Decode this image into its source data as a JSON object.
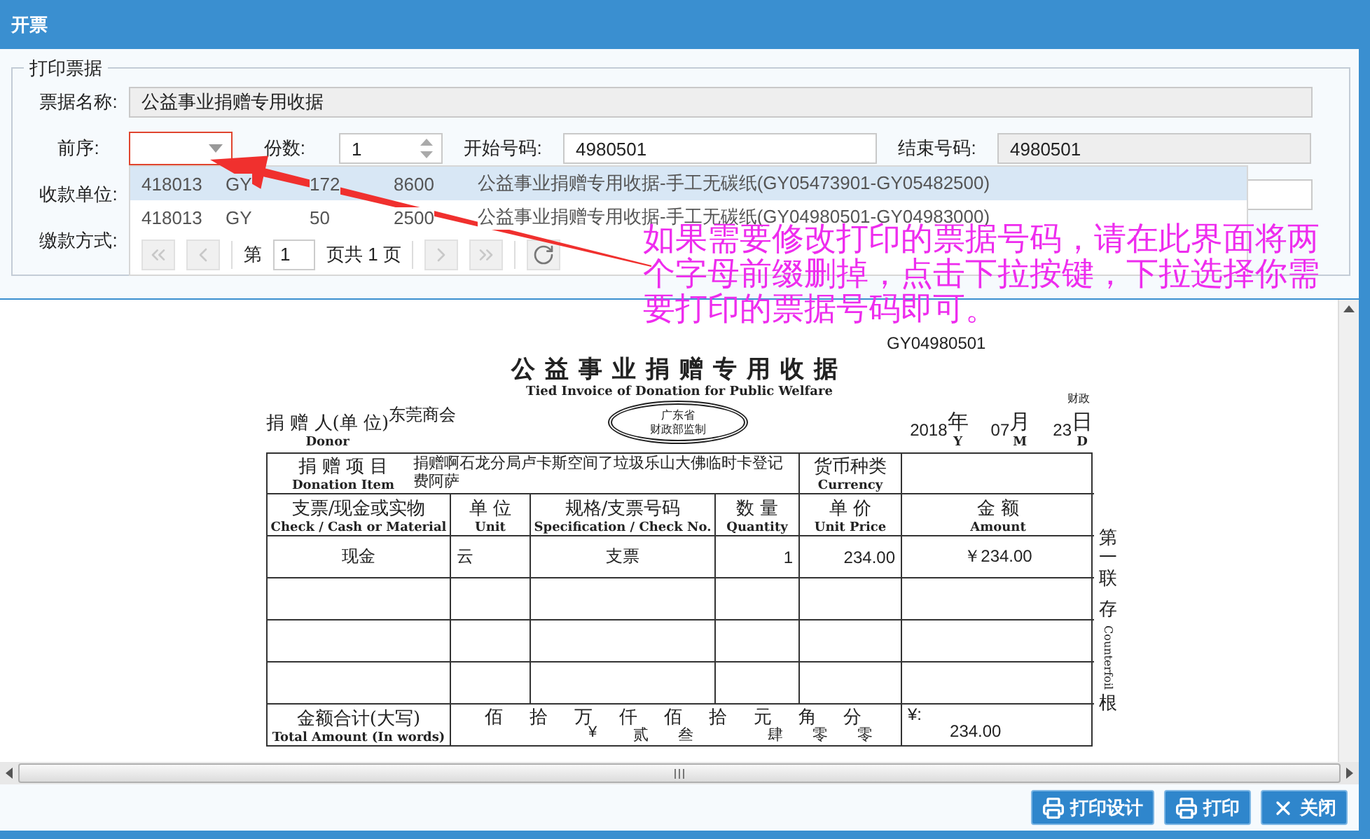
{
  "window": {
    "title": "开票"
  },
  "form": {
    "legend": "打印票据",
    "ticket_name": {
      "label": "票据名称:",
      "value": "公益事业捐赠专用收据"
    },
    "prefix": {
      "label": "前序:",
      "focused": true
    },
    "copies": {
      "label": "份数:",
      "value": "1"
    },
    "start_no": {
      "label": "开始号码:",
      "value": "4980501"
    },
    "end_no": {
      "label": "结束号码:",
      "value": "4980501"
    },
    "payee": {
      "label": "收款单位:"
    },
    "payment_method": {
      "label": "缴款方式:"
    }
  },
  "dropdown": {
    "rows": [
      {
        "cells": [
          "418013",
          "GY",
          "172",
          "8600",
          "公益事业捐赠专用收据-手工无碳纸(GY05473901-GY05482500)"
        ],
        "selected": true
      },
      {
        "cells": [
          "418013",
          "GY",
          "50",
          "2500",
          "公益事业捐赠专用收据-手工无碳纸(GY04980501-GY04983000)"
        ],
        "selected": false
      }
    ],
    "pager": {
      "page_label": "第",
      "page": "1",
      "total_label": "页共 1 页",
      "buttons": [
        {
          "kind": "first",
          "disabled": true
        },
        {
          "kind": "prev",
          "disabled": true
        },
        {
          "kind": "next",
          "disabled": true
        },
        {
          "kind": "last",
          "disabled": true
        },
        {
          "kind": "refresh",
          "disabled": false
        }
      ]
    }
  },
  "annotation": "如果需要修改打印的票据号码，请在此界面将两个字母前缀删掉，点击下拉按键，下拉选择你需要打印的票据号码即可。",
  "receipt": {
    "serial": "GY04980501",
    "title": "公益事业捐赠专用收据",
    "subtitle": "Tied Invoice of Donation for Public Welfare",
    "stamp": [
      "广东省",
      "财政部监制"
    ],
    "corner_mark": "财政",
    "donor": {
      "label": "捐 赠 人(单 位)",
      "en": "Donor",
      "value": "东莞商会"
    },
    "date": [
      {
        "value": "2018",
        "unit": "年",
        "en": "Y"
      },
      {
        "value": "07",
        "unit": "月",
        "en": "M"
      },
      {
        "value": "23",
        "unit": "日",
        "en": "D"
      }
    ],
    "item": {
      "label": "捐 赠 项 目",
      "en": "Donation Item",
      "value": "捐赠啊石龙分局卢卡斯空间了垃圾乐山大佛临时卡登记费阿萨"
    },
    "currency": {
      "label": "货币种类",
      "en": "Currency"
    },
    "columns": [
      {
        "label": "支票/现金或实物",
        "en": "Check / Cash or Material"
      },
      {
        "label": "单 位",
        "en": "Unit"
      },
      {
        "label": "规格/支票号码",
        "en": "Specification / Check No."
      },
      {
        "label": "数 量",
        "en": "Quantity"
      },
      {
        "label": "单 价",
        "en": "Unit Price"
      },
      {
        "label": "金 额",
        "en": "Amount"
      }
    ],
    "rows": [
      [
        "现金",
        "云",
        "支票",
        "1",
        "234.00",
        "￥234.00"
      ]
    ],
    "total": {
      "label": "金额合计(大写)",
      "en": "Total Amount (In words)",
      "places": [
        {
          "unit": "佰"
        },
        {
          "unit": "拾"
        },
        {
          "unit": "万",
          "digit": "¥"
        },
        {
          "unit": "仟",
          "digit": "贰"
        },
        {
          "unit": "佰",
          "digit": "叁"
        },
        {
          "unit": "拾"
        },
        {
          "unit": "元",
          "digit": "肆"
        },
        {
          "unit": "角",
          "digit": "零"
        },
        {
          "unit": "分",
          "digit": "零"
        }
      ],
      "symbol": "¥:",
      "amount": "234.00"
    },
    "side": {
      "copy": "第一联",
      "stub_top": "存",
      "stub_bottom": "根",
      "en": "Counterfoil"
    }
  },
  "buttons": [
    {
      "label": "打印设计",
      "kind": "print"
    },
    {
      "label": "打印",
      "kind": "print"
    },
    {
      "label": "关闭",
      "kind": "close"
    }
  ]
}
